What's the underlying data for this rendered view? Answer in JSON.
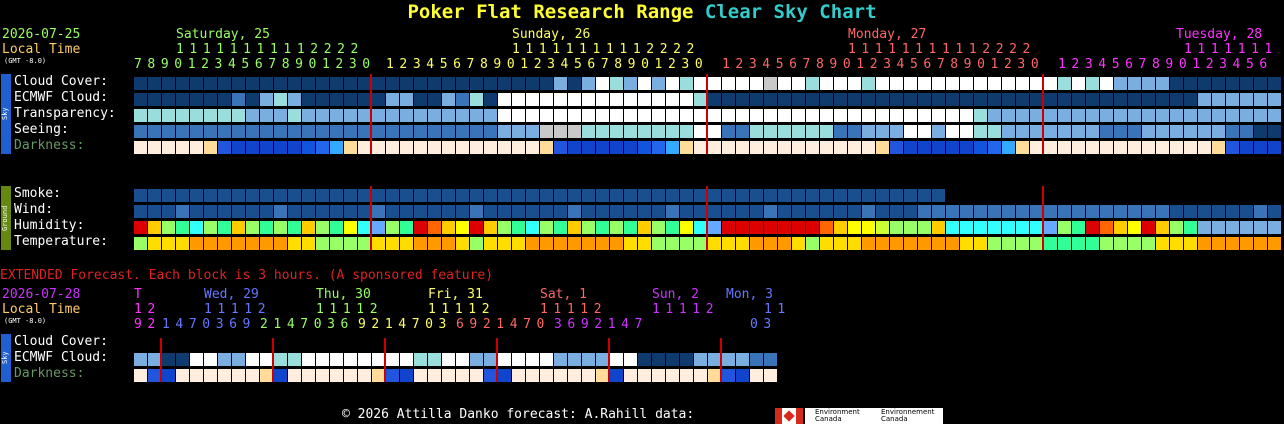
{
  "title": {
    "part1": "Poker Flat Research Range",
    "part2": "Clear Sky Chart"
  },
  "date": "2026-07-25",
  "local_time": "Local Time",
  "gmt": "(GMT -8.0)",
  "days": [
    {
      "label": "Saturday, 25",
      "color": "#99ff66"
    },
    {
      "label": "Sunday, 26",
      "color": "#ffff66"
    },
    {
      "label": "Monday, 27",
      "color": "#ff6666"
    },
    {
      "label": "Tuesday, 28",
      "color": "#ff33ff"
    }
  ],
  "hour_tens_row": [
    {
      "text": "11111111112222",
      "color": "#99ff66"
    },
    {
      "text": "11111111112222",
      "color": "#ffff66"
    },
    {
      "text": "11111111112222",
      "color": "#ff6666"
    },
    {
      "text": "1111111",
      "color": "#ff33ff"
    }
  ],
  "hour_units_row": [
    {
      "text": "789012345678901230",
      "color": "#99ff66"
    },
    {
      "text": "123456789012345678901230",
      "color": "#ffff66"
    },
    {
      "text": "123456789012345678901230",
      "color": "#ff6666"
    },
    {
      "text": "1234567890123456",
      "color": "#ff33ff"
    }
  ],
  "sky_label": "Sky",
  "ground_label": "Ground",
  "rows": {
    "cloud": "Cloud Cover:",
    "ecmwf": "ECMWF Cloud:",
    "transp": "Transparency:",
    "seeing": "Seeing:",
    "dark": "Darkness:",
    "smoke": "Smoke:",
    "wind": "Wind:",
    "humidity": "Humidity:",
    "temp": "Temperature:"
  },
  "colors": {
    "dark_blue": "#0f3a6e",
    "mid_blue": "#3a74b8",
    "light_blue": "#7aaee0",
    "cyan": "#99dddd",
    "white": "#ffffff",
    "grey": "#c8c8c8",
    "separator": "#cc0000"
  },
  "extended": {
    "header": "EXTENDED Forecast. Each block is 3 hours. (A sponsored feature)",
    "date": "2026-07-28",
    "local_time": "Local Time",
    "gmt": "(GMT -8.0)",
    "days": [
      {
        "label": "T",
        "color": "#ff33ff"
      },
      {
        "label": "Wed, 29",
        "color": "#6677ff"
      },
      {
        "label": "Thu, 30",
        "color": "#99ff66"
      },
      {
        "label": "Fri, 31",
        "color": "#ffff66"
      },
      {
        "label": "Sat, 1",
        "color": "#ff6666"
      },
      {
        "label": "Sun, 2",
        "color": "#cc33ff"
      },
      {
        "label": "Mon, 3",
        "color": "#6677ff"
      }
    ],
    "tens": [
      {
        "text": "12",
        "color": "#ff33ff"
      },
      {
        "text": "11112",
        "color": "#6677ff"
      },
      {
        "text": "11112",
        "color": "#99ff66"
      },
      {
        "text": "11112",
        "color": "#ffff66"
      },
      {
        "text": "11112",
        "color": "#ff6666"
      },
      {
        "text": "11112",
        "color": "#cc33ff"
      },
      {
        "text": "11",
        "color": "#6677ff"
      }
    ],
    "units": [
      {
        "text": "92",
        "color": "#ff33ff"
      },
      {
        "text": "1470369",
        "color": "#6677ff"
      },
      {
        "text": "2147036",
        "color": "#99ff66"
      },
      {
        "text": "9214703",
        "color": "#ffff66"
      },
      {
        "text": "6921470",
        "color": "#ff6666"
      },
      {
        "text": "3692147",
        "color": "#cc33ff"
      },
      {
        "text": "03",
        "color": "#6677ff"
      }
    ],
    "rows": {
      "cloud": "Cloud Cover:",
      "ecmwf": "ECMWF Cloud:",
      "dark": "Darkness:"
    }
  },
  "footer": {
    "credit": "© 2026 Attilla Danko  forecast: A.Rahill  data:",
    "env1": "Environment Canada",
    "env2": "Environnement Canada"
  }
}
